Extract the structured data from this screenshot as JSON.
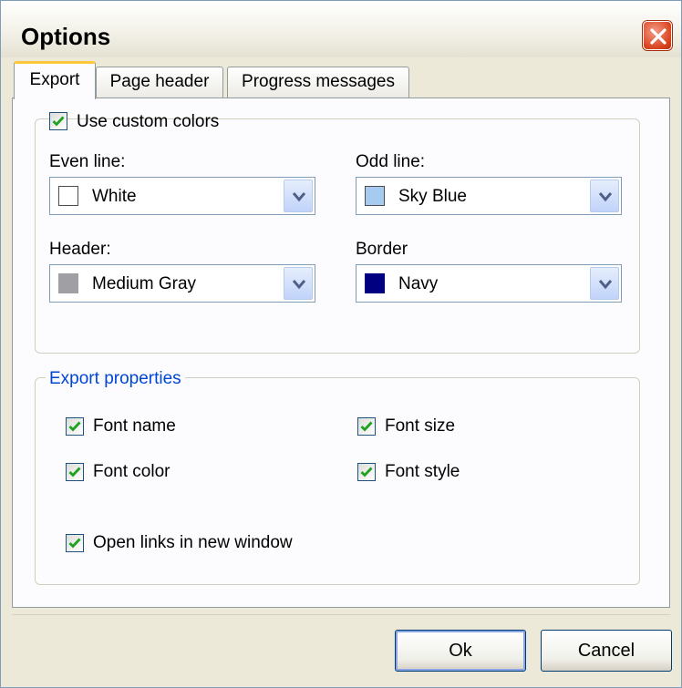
{
  "window": {
    "title": "Options"
  },
  "tabs": [
    {
      "label": "Export",
      "active": true
    },
    {
      "label": "Page header",
      "active": false
    },
    {
      "label": "Progress messages",
      "active": false
    }
  ],
  "custom_colors": {
    "checkbox_label": "Use custom colors",
    "checked": true,
    "even_line": {
      "label": "Even line:",
      "value": "White",
      "color": "#ffffff"
    },
    "odd_line": {
      "label": "Odd line:",
      "value": "Sky Blue",
      "color": "#a6caf0"
    },
    "header": {
      "label": "Header:",
      "value": "Medium Gray",
      "color": "#a0a0a4"
    },
    "border": {
      "label": "Border",
      "value": "Navy",
      "color": "#000080"
    }
  },
  "export_properties": {
    "legend": "Export properties",
    "font_name": {
      "label": "Font name",
      "checked": true
    },
    "font_size": {
      "label": "Font size",
      "checked": true
    },
    "font_color": {
      "label": "Font color",
      "checked": true
    },
    "font_style": {
      "label": "Font style",
      "checked": true
    },
    "open_links": {
      "label": "Open links in new window",
      "checked": true
    }
  },
  "buttons": {
    "ok": "Ok",
    "cancel": "Cancel"
  },
  "colors": {
    "accent_tab": "#ffc83c",
    "checkmark": "#21a121",
    "group_legend": "#0046d5",
    "close_button": "#d9431e"
  }
}
